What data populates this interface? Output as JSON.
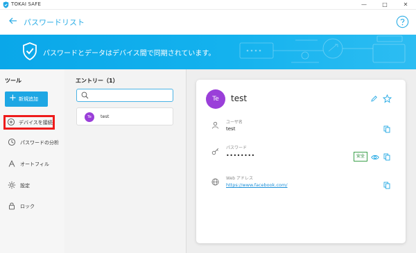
{
  "app": {
    "title": "TOKAI SAFE",
    "logo_icon": "shield-logo-icon"
  },
  "window_controls": {
    "minimize": "—",
    "maximize": "□",
    "close": "✕"
  },
  "header": {
    "title": "パスワードリスト",
    "back_icon": "arrow-left-icon",
    "help_icon": "question-circle-icon"
  },
  "banner": {
    "text": "パスワードとデータはデバイス間で同期されています。",
    "color": "#0aa7e9"
  },
  "sidebar": {
    "title": "ツール",
    "add_button": "新規追加",
    "items": [
      {
        "label": "デバイスを接続",
        "icon": "device-sync-icon",
        "highlighted": true
      },
      {
        "label": "パスワードの分析",
        "icon": "analysis-icon"
      },
      {
        "label": "オートフィル",
        "icon": "autofill-icon"
      },
      {
        "label": "設定",
        "icon": "gear-icon"
      },
      {
        "label": "ロック",
        "icon": "lock-icon"
      }
    ]
  },
  "entries": {
    "title": "エントリー（1）",
    "search_placeholder": "",
    "list": [
      {
        "initials": "Te",
        "name": "test"
      }
    ]
  },
  "detail": {
    "initials": "Te",
    "title": "test",
    "username_label": "ユーザ名",
    "username_value": "test",
    "password_label": "パスワード",
    "password_value": "••••••••",
    "safe_badge": "安全",
    "web_label": "Web アドレス",
    "web_value": "https://www.facebook.com/"
  },
  "colors": {
    "accent": "#1ea7e4",
    "avatar": "#9a3fd9",
    "highlight_border": "#ee1b1b",
    "safe": "#3aa04a"
  }
}
